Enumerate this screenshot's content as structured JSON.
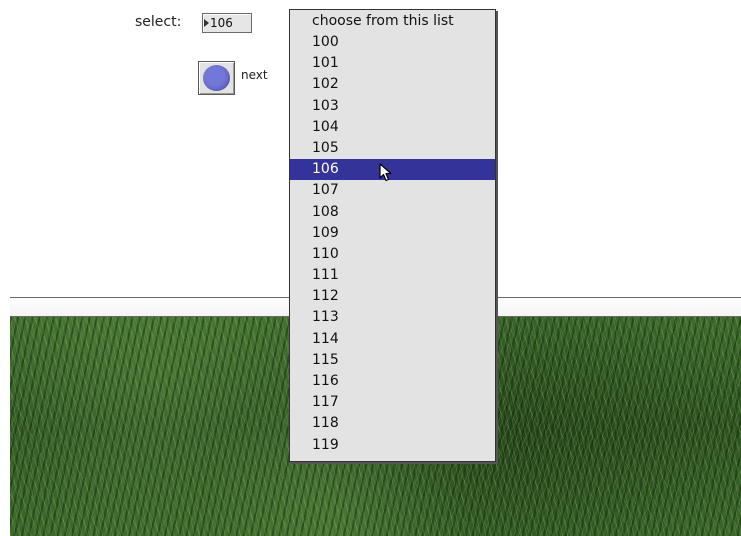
{
  "selector": {
    "label": "select:",
    "value": "106"
  },
  "next_button": {
    "label": "next",
    "color": "#7378d8"
  },
  "popup": {
    "header": "choose from this list",
    "selected": "106",
    "highlight_color": "#333399",
    "items": [
      "100",
      "101",
      "102",
      "103",
      "104",
      "105",
      "106",
      "107",
      "108",
      "109",
      "110",
      "111",
      "112",
      "113",
      "114",
      "115",
      "116",
      "117",
      "118",
      "119"
    ]
  },
  "cursor": {
    "icon": "arrow-cursor-icon"
  }
}
